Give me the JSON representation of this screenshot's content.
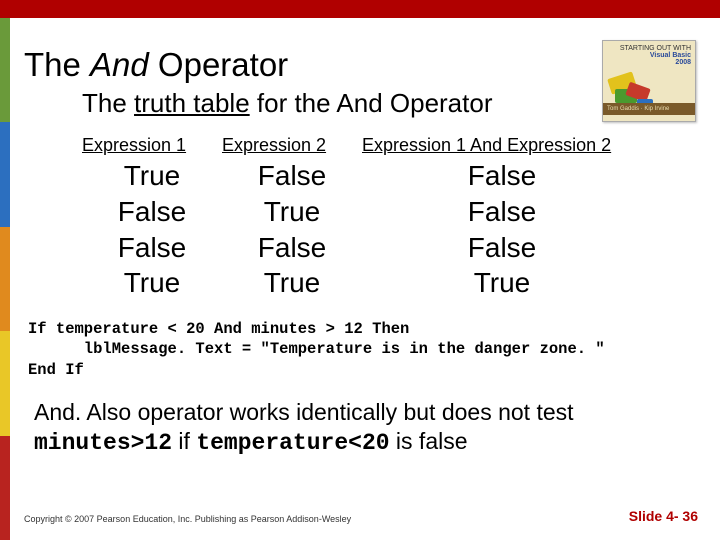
{
  "book": {
    "title_small": "STARTING OUT WITH",
    "title_main": "Visual Basic",
    "title_year": "2008",
    "band": "Tom Gaddis · Kip Irvine"
  },
  "heading": {
    "the": "The ",
    "and": "And",
    "rest": " Operator"
  },
  "subtitle": {
    "pre": "The ",
    "u": "truth table",
    "post": " for the And Operator"
  },
  "table": {
    "headers": [
      "Expression 1",
      "Expression 2",
      "Expression 1 And Expression 2"
    ],
    "rows": [
      [
        "True",
        "False",
        "False"
      ],
      [
        "False",
        "True",
        "False"
      ],
      [
        "False",
        "False",
        "False"
      ],
      [
        "True",
        "True",
        "True"
      ]
    ]
  },
  "code": "If temperature < 20 And minutes > 12 Then\n      lblMessage. Text = \"Temperature is in the danger zone. \"\nEnd If",
  "para": {
    "t1": "And. Also",
    "t2": " operator works identically but does not test ",
    "m1": "minutes>12",
    "t3": " if ",
    "m2": "temperature<20",
    "t4": " is false"
  },
  "footer": {
    "copyright": "Copyright © 2007 Pearson Education, Inc. Publishing as Pearson Addison-Wesley",
    "slide": "Slide 4- 36"
  }
}
